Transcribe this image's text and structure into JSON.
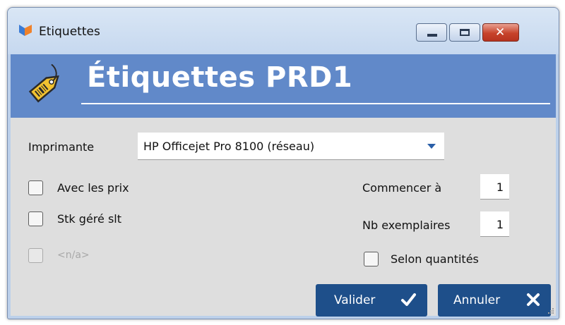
{
  "window": {
    "title": "Etiquettes",
    "controls": {
      "minimize_icon": "minimize-icon",
      "maximize_icon": "maximize-icon",
      "close_icon": "close-icon"
    }
  },
  "header": {
    "title": "Étiquettes PRD1",
    "icon": "price-tag-icon"
  },
  "form": {
    "printer_label": "Imprimante",
    "printer_value": "HP Officejet Pro 8100 (réseau)",
    "options": [
      {
        "label": "Avec les prix",
        "checked": false,
        "enabled": true
      },
      {
        "label": "Stk géré slt",
        "checked": false,
        "enabled": true
      },
      {
        "label": "<n/a>",
        "checked": false,
        "enabled": false
      }
    ],
    "start_label": "Commencer à",
    "start_value": "1",
    "copies_label": "Nb exemplaires",
    "copies_value": "1",
    "by_quantity_label": "Selon quantités",
    "by_quantity_checked": false
  },
  "buttons": {
    "validate_label": "Valider",
    "cancel_label": "Annuler"
  },
  "colors": {
    "header_band": "#6189c9",
    "button": "#1e4f8a",
    "body": "#dedede"
  }
}
